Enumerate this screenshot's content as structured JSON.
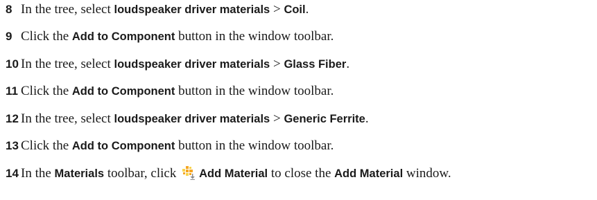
{
  "steps": [
    {
      "number": "8",
      "t1": "In the tree, select ",
      "b1": "loudspeaker driver materials",
      "t2": " > ",
      "b2": "Coil",
      "t3": "."
    },
    {
      "number": "9",
      "t1": "Click the ",
      "b1": "Add to Component",
      "t2": " button in the window toolbar."
    },
    {
      "number": "10",
      "t1": "In the tree, select ",
      "b1": "loudspeaker driver materials",
      "t2": " > ",
      "b2": "Glass Fiber",
      "t3": "."
    },
    {
      "number": "11",
      "t1": "Click the ",
      "b1": "Add to Component",
      "t2": " button in the window toolbar."
    },
    {
      "number": "12",
      "t1": "In the tree, select ",
      "b1": "loudspeaker driver materials",
      "t2": " > ",
      "b2": "Generic Ferrite",
      "t3": "."
    },
    {
      "number": "13",
      "t1": "Click the ",
      "b1": "Add to Component",
      "t2": " button in the window toolbar."
    },
    {
      "number": "14",
      "t1": "In the ",
      "b1": "Materials",
      "t2": " toolbar, click ",
      "icon": "add-material-icon",
      "b2": "Add Material",
      "t3": " to close the ",
      "b3": "Add Material",
      "t4": " window."
    }
  ],
  "colors": {
    "text": "#1a1a1a",
    "icon_orange": "#f5a623",
    "icon_yellow": "#f8d44c",
    "icon_arrow": "#8a8a8a"
  }
}
